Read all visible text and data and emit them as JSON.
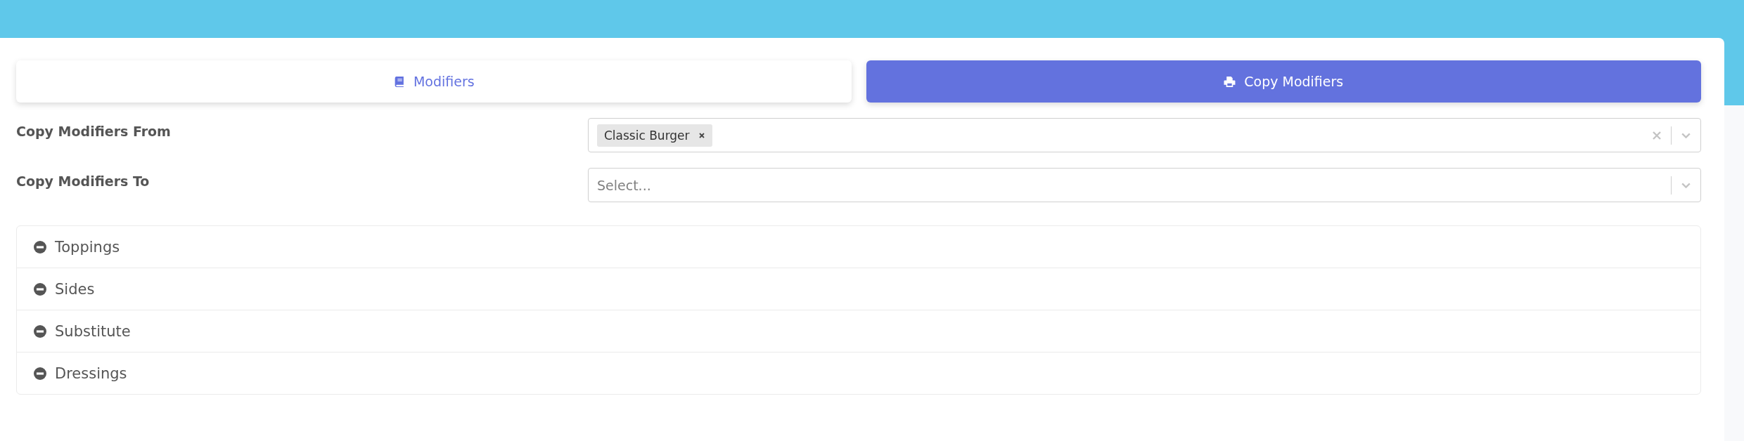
{
  "tabs": [
    {
      "label": "Modifiers",
      "selected": false
    },
    {
      "label": "Copy Modifiers",
      "selected": true
    }
  ],
  "fields": [
    {
      "label": "Copy Modifiers From",
      "tags": [
        "Classic Burger"
      ]
    },
    {
      "label": "Copy Modifiers To",
      "placeholder": "Select..."
    }
  ],
  "groups": [
    {
      "label": "Toppings"
    },
    {
      "label": "Sides"
    },
    {
      "label": "Substitute"
    },
    {
      "label": "Dressings"
    }
  ]
}
